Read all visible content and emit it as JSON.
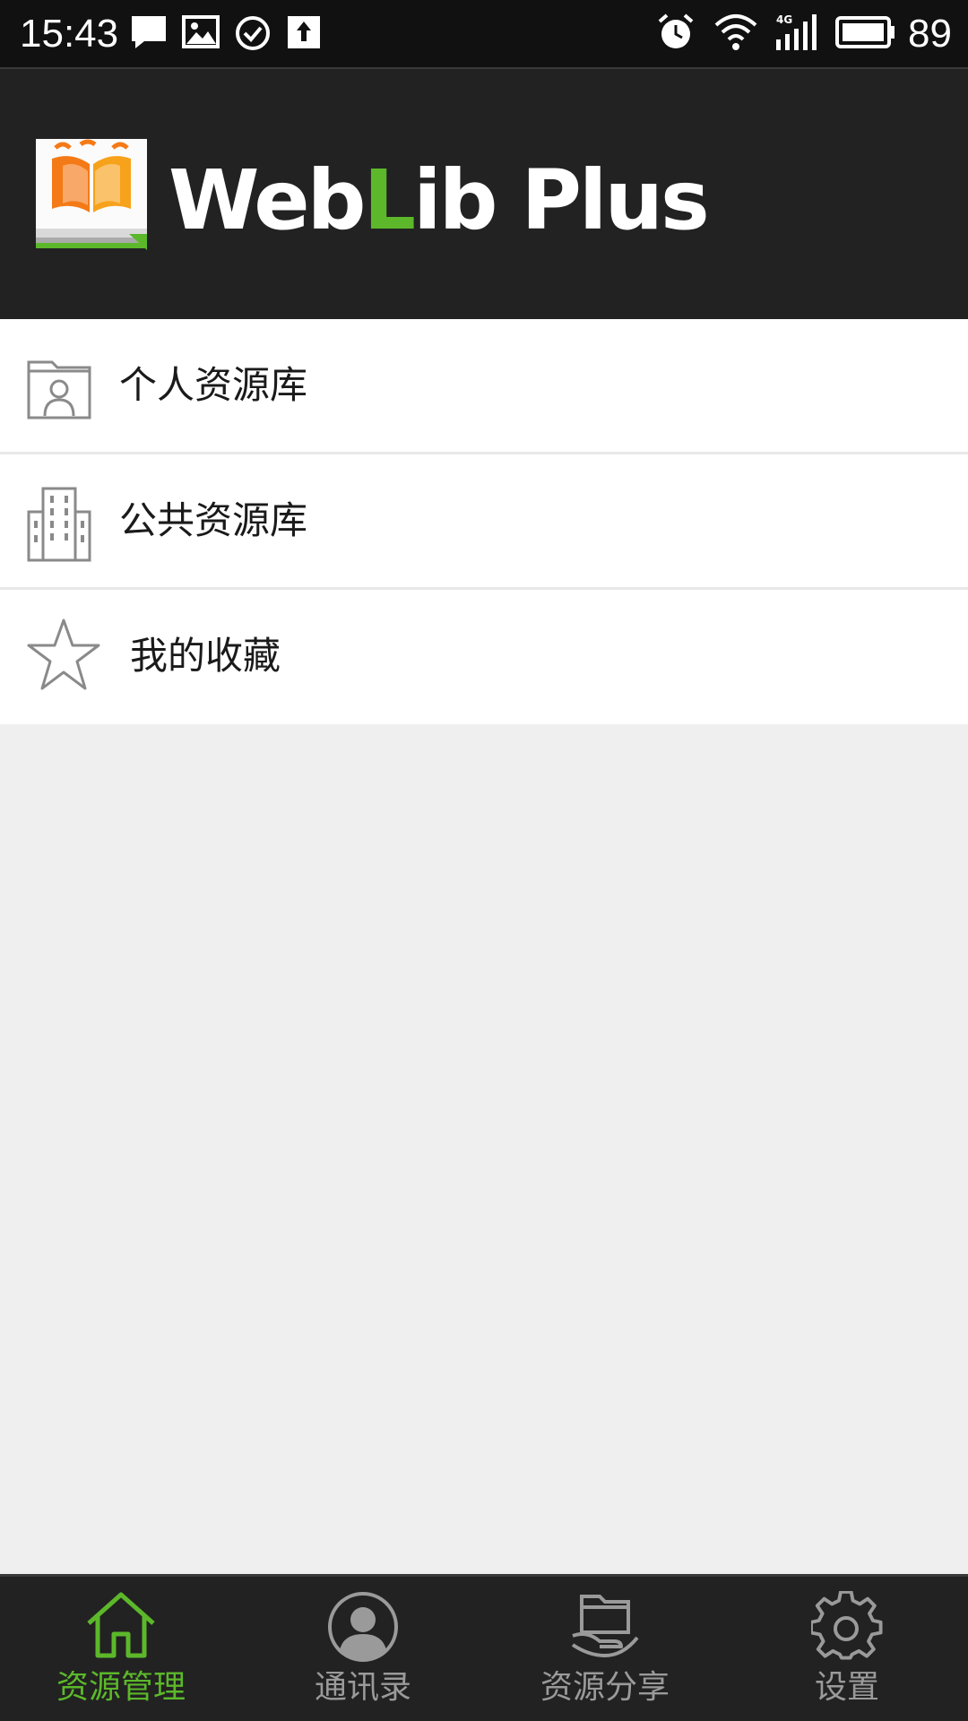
{
  "status_bar": {
    "time": "15:43",
    "battery_level": "89",
    "icons": [
      "message-icon",
      "image-icon",
      "check-circle-icon",
      "upload-icon",
      "alarm-icon",
      "wifi-icon",
      "signal-4g-icon",
      "battery-icon"
    ]
  },
  "header": {
    "logo_text_a": "Web",
    "logo_text_b": "L",
    "logo_text_c": "ib Plus",
    "logo_icon": "open-book-logo"
  },
  "menu": {
    "items": [
      {
        "label": "个人资源库",
        "icon": "personal-folder-icon"
      },
      {
        "label": "公共资源库",
        "icon": "building-icon"
      },
      {
        "label": "我的收藏",
        "icon": "star-icon"
      }
    ]
  },
  "bottom_nav": {
    "items": [
      {
        "label": "资源管理",
        "icon": "home-icon",
        "active": true
      },
      {
        "label": "通讯录",
        "icon": "contact-icon",
        "active": false
      },
      {
        "label": "资源分享",
        "icon": "share-folder-icon",
        "active": false
      },
      {
        "label": "设置",
        "icon": "gear-icon",
        "active": false
      }
    ]
  },
  "colors": {
    "accent": "#5cb82a",
    "header_bg": "#222222",
    "status_bg": "#111111",
    "page_bg": "#efefef",
    "nav_inactive": "#9a9a9a"
  }
}
